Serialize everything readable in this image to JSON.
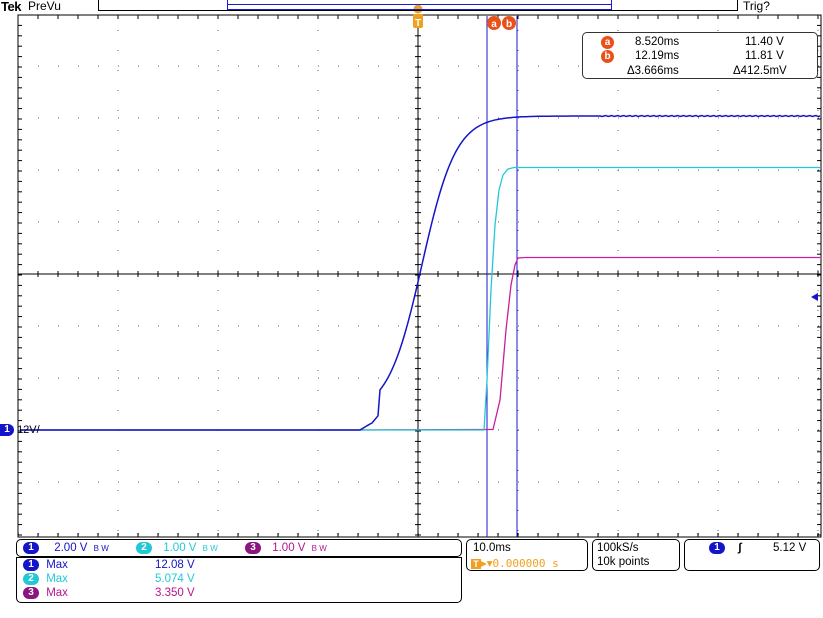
{
  "header": {
    "brand": "Tek",
    "mode": "PreVu",
    "trigger_status": "Trig?"
  },
  "markers": {
    "trigger_marker": "T",
    "cursor_a": "a",
    "cursor_b": "b"
  },
  "cursor_readout": {
    "a_time": "8.520ms",
    "a_volt": "11.40 V",
    "b_time": "12.19ms",
    "b_volt": "11.81 V",
    "delta_time": "Δ3.666ms",
    "delta_volt": "Δ412.5mV"
  },
  "ground_marker": {
    "channel": "1",
    "label": "12V/"
  },
  "channels": {
    "ch1": {
      "num": "1",
      "scale": "2.00 V",
      "bw": "B W",
      "color": "#1414c8"
    },
    "ch2": {
      "num": "2",
      "scale": "1.00 V",
      "bw": "B W",
      "color": "#00c8d2"
    },
    "ch3": {
      "num": "3",
      "scale": "1.00 V",
      "bw": "B W",
      "color": "#b4148c"
    }
  },
  "measurements": [
    {
      "num": "1",
      "label": "Max",
      "value": "12.08 V"
    },
    {
      "num": "2",
      "label": "Max",
      "value": "5.074 V"
    },
    {
      "num": "3",
      "label": "Max",
      "value": "3.350 V"
    }
  ],
  "timebase": {
    "scale": "10.0ms",
    "delay": "0.000000 s"
  },
  "acquisition": {
    "rate": "100kS/s",
    "points": "10k points"
  },
  "trigger": {
    "channel": "1",
    "slope_symbol": "∫",
    "level": "5.12 V"
  }
}
